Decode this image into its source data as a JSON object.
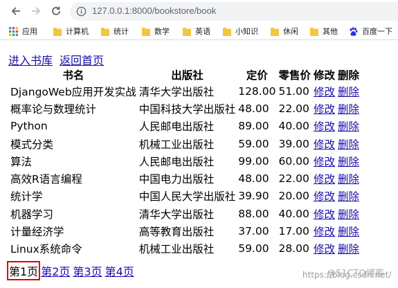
{
  "browser": {
    "url": "127.0.0.1:8000/bookstore/book",
    "bookmarks": [
      {
        "label": "应用",
        "icon": "apps-grid-icon"
      },
      {
        "label": "计算机",
        "icon": "folder-icon"
      },
      {
        "label": "统计",
        "icon": "folder-icon"
      },
      {
        "label": "数学",
        "icon": "folder-icon"
      },
      {
        "label": "英语",
        "icon": "folder-icon"
      },
      {
        "label": "小知识",
        "icon": "folder-icon"
      },
      {
        "label": "休闲",
        "icon": "folder-icon"
      },
      {
        "label": "其他",
        "icon": "folder-icon"
      },
      {
        "label": "百度一下",
        "icon": "baidu-paw-icon"
      }
    ]
  },
  "page": {
    "links": {
      "enter_store": "进入书库",
      "back_home": "返回首页"
    },
    "table": {
      "headers": [
        "书名",
        "出版社",
        "定价",
        "零售价",
        "修改",
        "删除"
      ],
      "rows": [
        {
          "title": "DjangoWeb应用开发实战",
          "publisher": "清华大学出版社",
          "price": "128.00",
          "retail": "51.00",
          "edit": "修改",
          "delete": "删除"
        },
        {
          "title": "概率论与数理统计",
          "publisher": "中国科技大学出版社",
          "price": "48.00",
          "retail": "22.00",
          "edit": "修改",
          "delete": "删除"
        },
        {
          "title": "Python",
          "publisher": "人民邮电出版社",
          "price": "89.00",
          "retail": "40.00",
          "edit": "修改",
          "delete": "删除"
        },
        {
          "title": "模式分类",
          "publisher": "机械工业出版社",
          "price": "59.00",
          "retail": "39.00",
          "edit": "修改",
          "delete": "删除"
        },
        {
          "title": "算法",
          "publisher": "人民邮电出版社",
          "price": "99.00",
          "retail": "60.00",
          "edit": "修改",
          "delete": "删除"
        },
        {
          "title": "高效R语言编程",
          "publisher": "中国电力出版社",
          "price": "48.00",
          "retail": "22.00",
          "edit": "修改",
          "delete": "删除"
        },
        {
          "title": "统计学",
          "publisher": "中国人民大学出版社",
          "price": "39.90",
          "retail": "20.00",
          "edit": "修改",
          "delete": "删除"
        },
        {
          "title": "机器学习",
          "publisher": "清华大学出版社",
          "price": "88.00",
          "retail": "40.00",
          "edit": "修改",
          "delete": "删除"
        },
        {
          "title": "计量经济学",
          "publisher": "高等教育出版社",
          "price": "37.00",
          "retail": "17.00",
          "edit": "修改",
          "delete": "删除"
        },
        {
          "title": "Linux系统命令",
          "publisher": "机械工业出版社",
          "price": "59.00",
          "retail": "28.00",
          "edit": "修改",
          "delete": "删除"
        }
      ]
    },
    "pager": {
      "current": "第1页",
      "pages": [
        "第2页",
        "第3页",
        "第4页"
      ]
    },
    "watermark": {
      "left": "https://blog.csdn.net/",
      "right": "@51CTO博客"
    }
  },
  "colors": {
    "link": "#1a0dab",
    "highlight_box": "#e00000",
    "folder": "#f4c542"
  }
}
